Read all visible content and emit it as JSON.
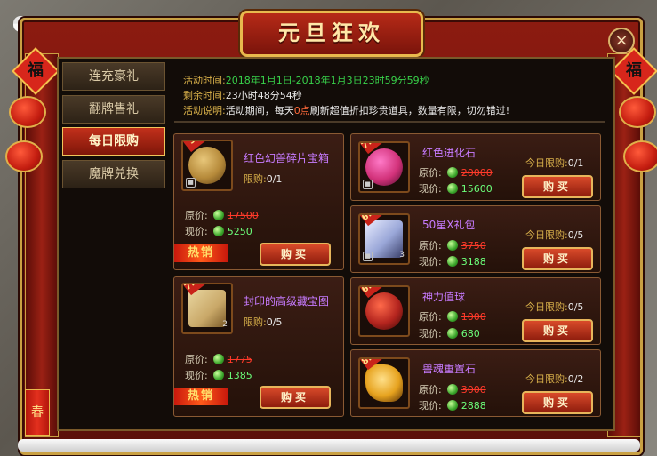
{
  "window": {
    "title": "元旦狂欢",
    "close_icon": "×"
  },
  "decor": {
    "fu_char": "福",
    "firecracker_char": "春"
  },
  "sidebar": {
    "items": [
      {
        "label": "连充豪礼",
        "active": false
      },
      {
        "label": "翻牌售礼",
        "active": false
      },
      {
        "label": "每日限购",
        "active": true
      },
      {
        "label": "魔牌兑换",
        "active": false
      }
    ]
  },
  "info": {
    "time_label": "活动时间:",
    "time_value": "2018年1月1日-2018年1月3日23时59分59秒",
    "remain_label": "剩余时间:",
    "remain_value": "23小时48分54秒",
    "desc_label": "活动说明:",
    "desc_pre": "活动期间，每天",
    "desc_highlight": "0点",
    "desc_post": "刷新超值折扣珍贵道具，数量有限，切勿错过!"
  },
  "labels": {
    "original": "原价:",
    "current": "现价:",
    "buy": "购买",
    "hot": "热销",
    "today_limit": "今日限购:",
    "limit": "限购:"
  },
  "items": [
    {
      "name": "红色幻兽碎片宝箱",
      "discount": "3折",
      "limit": "0/1",
      "original": "17500",
      "current": "5250",
      "hot": true,
      "art": "#b68a3a"
    },
    {
      "name": "封印的高级藏宝图",
      "discount": "7.8折",
      "limit": "0/5",
      "original": "1775",
      "current": "1385",
      "hot": true,
      "count": "2",
      "art": "#c9a868"
    },
    {
      "name": "红色进化石",
      "discount": "7.8折",
      "limit": "0/1",
      "original": "20000",
      "current": "15600",
      "art": "#d2327a"
    },
    {
      "name": "50星X礼包",
      "discount": "6.8折",
      "limit": "0/5",
      "original": "3750",
      "current": "3188",
      "count": "3",
      "art": "#9aa7d8"
    },
    {
      "name": "神力值球",
      "discount": "6.8折",
      "limit": "0/5",
      "original": "1000",
      "current": "680",
      "art": "#b3241e"
    },
    {
      "name": "兽魂重置石",
      "discount": "8.3折",
      "limit": "0/2",
      "original": "3000",
      "current": "2888",
      "art": "#e6a21e"
    }
  ],
  "colors": {
    "accent_gold": "#e8b94d",
    "frame_red": "#8c1b10",
    "price_green": "#6cff7a",
    "price_old": "#ff3a2a",
    "item_name": "#c77bff"
  }
}
